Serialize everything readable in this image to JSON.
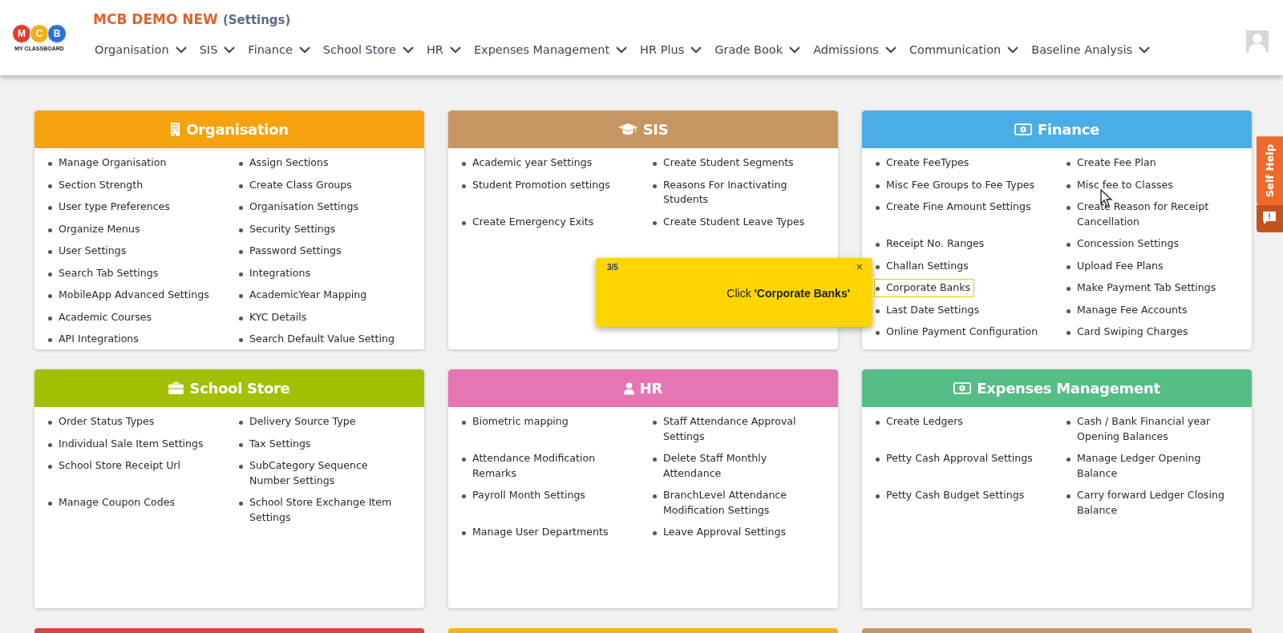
{
  "header": {
    "logo": {
      "letters": [
        "M",
        "C",
        "B"
      ],
      "caption": "MY CLASSBOARD"
    },
    "title": "MCB DEMO NEW",
    "subtitle": "(Settings)",
    "nav": [
      {
        "label": "Organisation"
      },
      {
        "label": "SIS"
      },
      {
        "label": "Finance"
      },
      {
        "label": "School Store"
      },
      {
        "label": "HR"
      },
      {
        "label": "Expenses Management"
      },
      {
        "label": "HR Plus"
      },
      {
        "label": "Grade Book"
      },
      {
        "label": "Admissions"
      },
      {
        "label": "Communication"
      },
      {
        "label": "Baseline Analysis"
      }
    ]
  },
  "cards": [
    {
      "title": "Organisation",
      "color": "#f4a30f",
      "items": [
        {
          "label": "Manage Organisation"
        },
        {
          "label": "Assign Sections"
        },
        {
          "label": "Section Strength"
        },
        {
          "label": "Create Class Groups"
        },
        {
          "label": "User type Preferences"
        },
        {
          "label": "Organisation Settings"
        },
        {
          "label": "Organize Menus"
        },
        {
          "label": "Security Settings"
        },
        {
          "label": "User Settings"
        },
        {
          "label": "Password Settings"
        },
        {
          "label": "Search Tab Settings"
        },
        {
          "label": "Integrations"
        },
        {
          "label": "MobileApp Advanced Settings"
        },
        {
          "label": "AcademicYear Mapping"
        },
        {
          "label": "Academic Courses"
        },
        {
          "label": "KYC Details"
        },
        {
          "label": "API Integrations"
        },
        {
          "label": "Search Default Value Setting"
        }
      ]
    },
    {
      "title": "SIS",
      "color": "#c69662",
      "items": [
        {
          "label": "Academic year Settings"
        },
        {
          "label": "Create Student Segments"
        },
        {
          "label": "Student Promotion settings"
        },
        {
          "label": "Reasons For Inactivating Students"
        },
        {
          "label": "Create Emergency Exits"
        },
        {
          "label": "Create Student Leave Types"
        }
      ]
    },
    {
      "title": "Finance",
      "color": "#4aade6",
      "items": [
        {
          "label": "Create FeeTypes",
          "highlighted": false
        },
        {
          "label": "Create Fee Plan",
          "highlighted": false
        },
        {
          "label": "Misc Fee Groups to Fee Types",
          "highlighted": false
        },
        {
          "label": "Misc fee to Classes",
          "highlighted": false
        },
        {
          "label": "Create Fine Amount Settings",
          "highlighted": false
        },
        {
          "label": "Create Reason for Receipt Cancellation",
          "highlighted": false
        },
        {
          "label": "Receipt No. Ranges",
          "highlighted": false
        },
        {
          "label": "Concession Settings",
          "highlighted": false
        },
        {
          "label": "Challan Settings",
          "highlighted": false
        },
        {
          "label": "Upload Fee Plans",
          "highlighted": false
        },
        {
          "label": "Corporate Banks",
          "highlighted": true
        },
        {
          "label": "Make Payment Tab Settings",
          "highlighted": false
        },
        {
          "label": "Last Date Settings",
          "highlighted": false
        },
        {
          "label": "Manage Fee Accounts",
          "highlighted": false
        },
        {
          "label": "Online Payment Configuration",
          "highlighted": false
        },
        {
          "label": "Card Swiping Charges",
          "highlighted": false
        }
      ]
    },
    {
      "title": "School Store",
      "color": "#a3bf00",
      "items": [
        {
          "label": "Order Status Types"
        },
        {
          "label": "Delivery Source Type"
        },
        {
          "label": "Individual Sale Item Settings"
        },
        {
          "label": "Tax Settings"
        },
        {
          "label": "School Store Receipt Url"
        },
        {
          "label": "SubCategory Sequence Number Settings"
        },
        {
          "label": "Manage Coupon Codes"
        },
        {
          "label": "School Store Exchange Item Settings"
        }
      ]
    },
    {
      "title": "HR",
      "color": "#e576b3",
      "items": [
        {
          "label": "Biometric mapping"
        },
        {
          "label": "Staff Attendance Approval Settings"
        },
        {
          "label": "Attendance Modification Remarks"
        },
        {
          "label": "Delete Staff Monthly Attendance"
        },
        {
          "label": "Payroll Month Settings"
        },
        {
          "label": "BranchLevel Attendance Modification Settings"
        },
        {
          "label": "Manage User Departments"
        },
        {
          "label": "Leave Approval Settings"
        }
      ]
    },
    {
      "title": "Expenses Management",
      "color": "#55bd86",
      "items": [
        {
          "label": "Create Ledgers"
        },
        {
          "label": "Cash / Bank Financial year Opening Balances"
        },
        {
          "label": "Petty Cash Approval Settings"
        },
        {
          "label": "Manage Ledger Opening Balance"
        },
        {
          "label": "Petty Cash Budget Settings"
        },
        {
          "label": "Carry forward Ledger Closing Balance"
        }
      ]
    }
  ],
  "more_cards": [
    {
      "color": "#e0413a"
    },
    {
      "color": "#f5b316"
    },
    {
      "color": "#c69662"
    }
  ],
  "tour_popup": {
    "step": "3/5",
    "close": "×",
    "message": "Click **'Corporate Banks'**"
  },
  "self_help": {
    "label": "Self Help"
  }
}
